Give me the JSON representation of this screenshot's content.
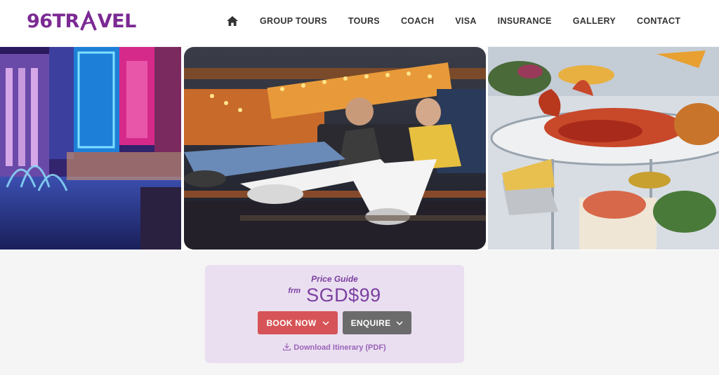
{
  "brand": {
    "logo_text_prefix": "96TR",
    "logo_text_suffix": "VEL",
    "color": "#7b2a93"
  },
  "nav": {
    "home_icon": "home-icon",
    "items": [
      "GROUP TOURS",
      "TOURS",
      "COACH",
      "VISA",
      "INSURANCE",
      "GALLERY",
      "CONTACT"
    ]
  },
  "gallery": {
    "images": [
      "night-city-fountain-photo",
      "amusement-ride-couple-photo",
      "lobster-seafood-platter-photo"
    ]
  },
  "pricing": {
    "label": "Price Guide",
    "prefix": "frm",
    "amount": "SGD$99",
    "book_label": "BOOK NOW",
    "enquire_label": "ENQUIRE",
    "download_label": "Download Itinerary (PDF)"
  },
  "colors": {
    "panel_bg": "#eadff0",
    "accent": "#7b3fa0",
    "book_btn": "#d65457",
    "enquire_btn": "#6b6b6b"
  }
}
